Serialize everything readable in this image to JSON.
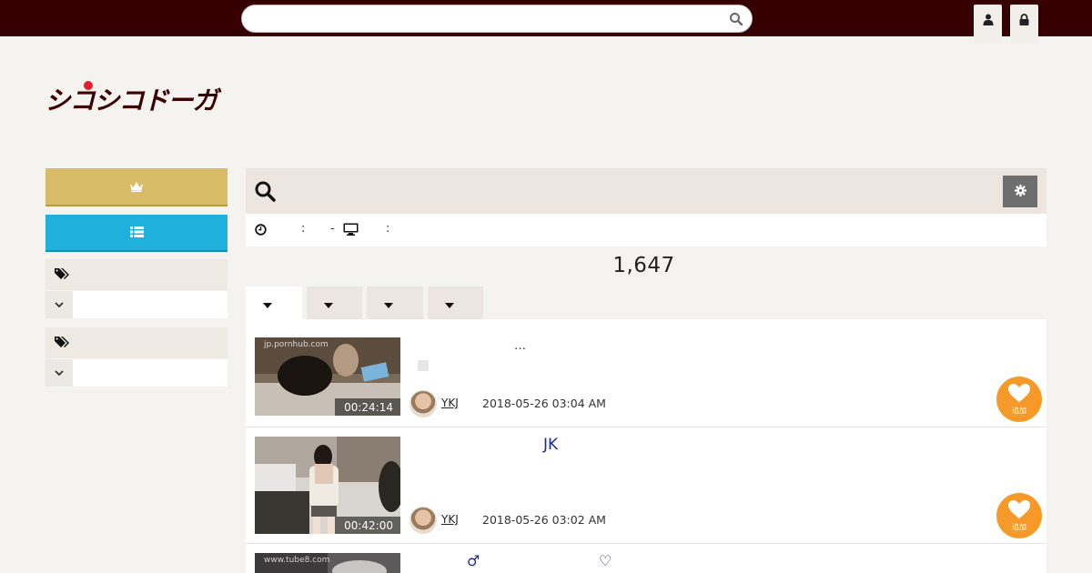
{
  "header": {
    "search_placeholder": "",
    "search_icon": "search-icon",
    "user_icon": "user-icon",
    "lock_icon": "lock-icon",
    "bg_color": "#360000"
  },
  "logo": {
    "text": "シコシコドーガ",
    "brand_color": "#360000"
  },
  "sidebar": {
    "ranking_icon": "crown-icon",
    "list_icon": "list-icon",
    "ranking_color": "#d9bc68",
    "list_color": "#20b0dc",
    "tag_groups": [
      {
        "icon": "tags-icon",
        "selected": ""
      },
      {
        "icon": "tags-icon",
        "selected": ""
      }
    ]
  },
  "panel": {
    "search_icon": "search-icon",
    "settings_icon": "gear-icon",
    "info": {
      "clock_sep": ":",
      "dash": "-",
      "monitor_sep": ":"
    },
    "total_count": "1,647",
    "tabs": [
      {
        "label": ""
      },
      {
        "label": ""
      },
      {
        "label": ""
      },
      {
        "label": ""
      }
    ]
  },
  "videos": [
    {
      "watermark": "jp.pornhub.com",
      "duration": "00:24:14",
      "title": "…",
      "user": "YKJ",
      "date": "2018-05-26 03:04 AM",
      "fav_label": "追加"
    },
    {
      "watermark": "",
      "duration": "00:42:00",
      "title": "JK",
      "user": "YKJ",
      "date": "2018-05-26 03:02 AM",
      "fav_label": "追加"
    },
    {
      "watermark": "www.tube8.com",
      "duration": "",
      "title_symbols": [
        "♂",
        "♡"
      ]
    }
  ]
}
